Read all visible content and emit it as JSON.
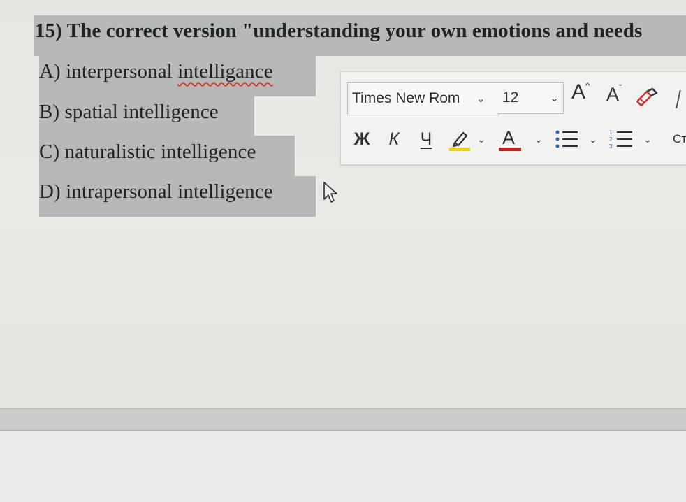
{
  "question": {
    "title": "15) The correct version \"understanding your own emotions and needs",
    "options": [
      {
        "label_prefix": "A) interpersonal ",
        "label_misspelled": "intelligance"
      },
      {
        "label": "B) spatial intelligence"
      },
      {
        "label": "C) naturalistic intelligence"
      },
      {
        "label": "D) intrapersonal intelligence"
      }
    ]
  },
  "mini_toolbar": {
    "font_name": "Times New Rom",
    "font_size": "12",
    "grow_font": "A",
    "shrink_font": "A",
    "bold": "Ж",
    "italic": "К",
    "underline": "Ч",
    "font_color_letter": "A",
    "styles_truncated": "Ст",
    "icons": {
      "format_painter": "paintbrush-icon",
      "highlight": "highlighter-icon",
      "bullets": "bullet-list-icon",
      "numbering": "numbered-list-icon"
    },
    "colors": {
      "highlight": "#f0d400",
      "font_color": "#d11f1f"
    }
  },
  "colors": {
    "selection_highlight": "#b6b9b7"
  }
}
